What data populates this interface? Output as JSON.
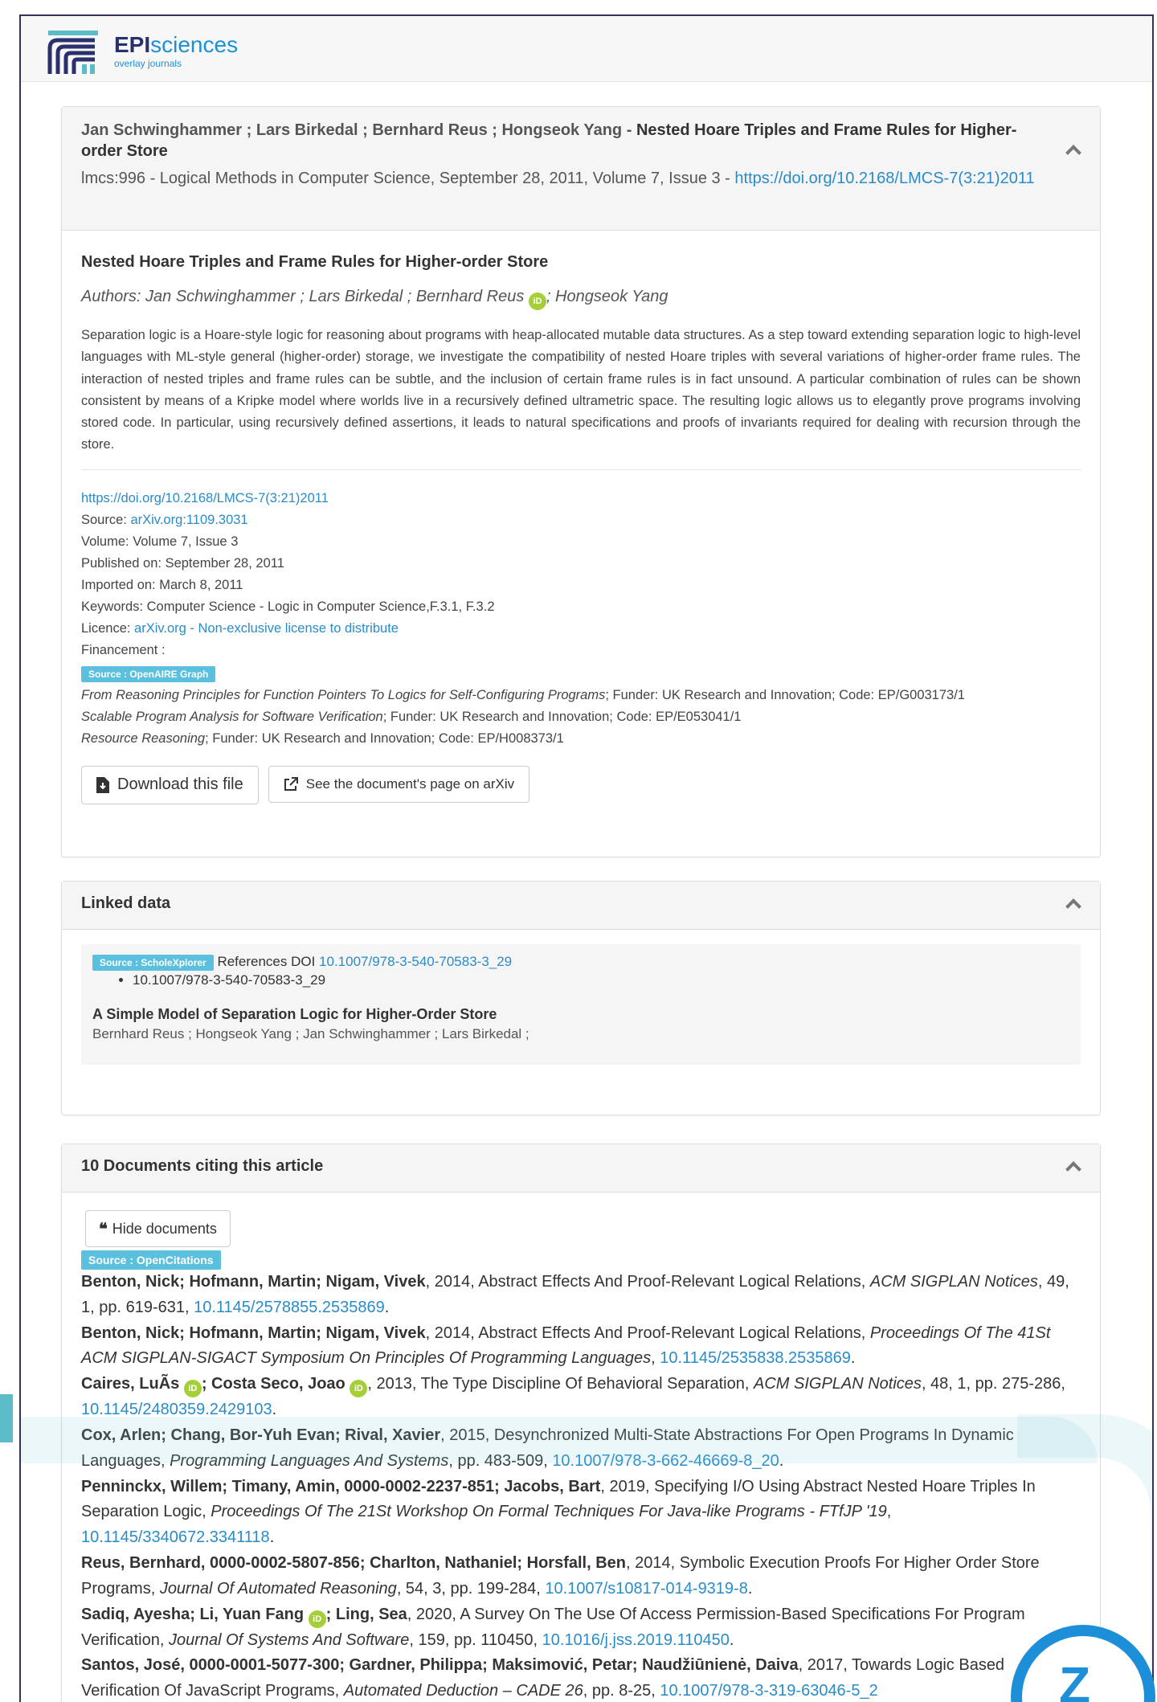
{
  "brand": {
    "epi": "EPI",
    "sciences": "sciences",
    "sub": "overlay journals"
  },
  "header": {
    "authors": "Jan Schwinghammer ; Lars Birkedal ; Bernhard Reus ; Hongseok Yang",
    "sep": " - ",
    "title": "Nested Hoare Triples and Frame Rules for Higher-order Store",
    "journal": "lmcs:996 - Logical Methods in Computer Science, September 28, 2011, Volume 7, Issue 3 - ",
    "doi_link": "https://doi.org/10.2168/LMCS-7(3:21)2011"
  },
  "article": {
    "title": "Nested Hoare Triples and Frame Rules for Higher-order Store",
    "authors_prefix": "Authors: Jan Schwinghammer ; Lars Birkedal ; Bernhard Reus",
    "authors_suffix": "; Hongseok Yang",
    "orcid": "iD",
    "abstract": "Separation logic is a Hoare-style logic for reasoning about programs with heap-allocated mutable data structures. As a step toward extending separation logic to high-level languages with ML-style general (higher-order) storage, we investigate the compatibility of nested Hoare triples with several variations of higher-order frame rules. The interaction of nested triples and frame rules can be subtle, and the inclusion of certain frame rules is in fact unsound. A particular combination of rules can be shown consistent by means of a Kripke model where worlds live in a recursively defined ultrametric space. The resulting logic allows us to elegantly prove programs involving stored code. In particular, using recursively defined assertions, it leads to natural specifications and proofs of invariants required for dealing with recursion through the store.",
    "doi": "https://doi.org/10.2168/LMCS-7(3:21)2011",
    "source_label": "Source: ",
    "source": "arXiv.org:1109.3031",
    "volume": "Volume: Volume 7, Issue 3",
    "published": "Published on: September 28, 2011",
    "imported": "Imported on: March 8, 2011",
    "keywords": "Keywords: Computer Science - Logic in Computer Science,F.3.1, F.3.2",
    "licence_label": "Licence: ",
    "licence": "arXiv.org - Non-exclusive license to distribute",
    "financement": "Financement :",
    "funding_badge": "Source : OpenAIRE Graph",
    "fundings": [
      {
        "title": "From Reasoning Principles for Function Pointers To Logics for Self-Configuring Programs",
        "rest": "; Funder: UK Research and Innovation; Code: EP/G003173/1"
      },
      {
        "title": "Scalable Program Analysis for Software Verification",
        "rest": "; Funder: UK Research and Innovation; Code: EP/E053041/1"
      },
      {
        "title": "Resource Reasoning",
        "rest": "; Funder: UK Research and Innovation; Code: EP/H008373/1"
      }
    ],
    "download_btn": "Download this file",
    "arxiv_btn": "See the document's page on arXiv"
  },
  "linked": {
    "heading": "Linked data",
    "badge": "Source : ScholeXplorer",
    "ref_label": "References DOI ",
    "ref_doi": "10.1007/978-3-540-70583-3_29",
    "bullet": "10.1007/978-3-540-70583-3_29",
    "title": "A Simple Model of Separation Logic for Higher-Order Store",
    "authors": "Bernhard Reus ; Hongseok Yang ; Jan Schwinghammer ; Lars Birkedal ;"
  },
  "citing": {
    "heading": "10 Documents citing this article",
    "hide_btn": "Hide documents",
    "badge": "Source : OpenCitations",
    "items": [
      {
        "a": "Benton, Nick; Hofmann, Martin; Nigam, Vivek",
        "t": ", 2014, Abstract Effects And Proof-Relevant Logical Relations, ",
        "j": "ACM SIGPLAN Notices",
        "r": ", 49, 1, pp. 619-631, ",
        "d": "10.1145/2578855.2535869",
        "e": "."
      },
      {
        "a": "Benton, Nick; Hofmann, Martin; Nigam, Vivek",
        "t": ", 2014, Abstract Effects And Proof-Relevant Logical Relations, ",
        "j": "Proceedings Of The 41St ACM SIGPLAN-SIGACT Symposium On Principles Of Programming Languages",
        "r": ", ",
        "d": "10.1145/2535838.2535869",
        "e": "."
      },
      {
        "a": "Caires, LuÃs",
        "a2": "; Costa Seco, Joao",
        "t": ", 2013, The Type Discipline Of Behavioral Separation, ",
        "j": "ACM SIGPLAN Notices",
        "r": ", 48, 1, pp. 275-286, ",
        "d": "10.1145/2480359.2429103",
        "e": "."
      },
      {
        "a": "Cox, Arlen; Chang, Bor-Yuh Evan; Rival, Xavier",
        "t": ", 2015, Desynchronized Multi-State Abstractions For Open Programs In Dynamic Languages, ",
        "j": "Programming Languages And Systems",
        "r": ", pp. 483-509, ",
        "d": "10.1007/978-3-662-46669-8_20",
        "e": "."
      },
      {
        "a": "Penninckx, Willem; Timany, Amin, 0000-0002-2237-851; Jacobs, Bart",
        "t": ", 2019, Specifying I/O Using Abstract Nested Hoare Triples In Separation Logic, ",
        "j": "Proceedings Of The 21St Workshop On Formal Techniques For Java-like Programs - FTfJP '19",
        "r": ", ",
        "d": "10.1145/3340672.3341118",
        "e": "."
      },
      {
        "a": "Reus, Bernhard, 0000-0002-5807-856; Charlton, Nathaniel; Horsfall, Ben",
        "t": ", 2014, Symbolic Execution Proofs For Higher Order Store Programs, ",
        "j": "Journal Of Automated Reasoning",
        "r": ", 54, 3, pp. 199-284, ",
        "d": "10.1007/s10817-014-9319-8",
        "e": "."
      },
      {
        "a": "Sadiq, Ayesha; Li, Yuan Fang",
        "a2": "; Ling, Sea",
        "t": ", 2020, A Survey On The Use Of Access Permission-Based Specifications For Program Verification, ",
        "j": "Journal Of Systems And Software",
        "r": ", 159, pp. 110450, ",
        "d": "10.1016/j.jss.2019.110450",
        "e": "."
      },
      {
        "a": "Santos, José, 0000-0001-5077-300; Gardner, Philippa; Maksimović, Petar; Naudžiūnienė, Daiva",
        "t": ", 2017, Towards Logic Based Verification Of JavaScript Programs, ",
        "j": "Automated Deduction – CADE 26",
        "r": ", pp. 8-25, ",
        "d": "10.1007/978-3-319-63046-5_2",
        "e": ""
      }
    ]
  },
  "colors": {
    "accent": "#2a8bc9",
    "badge": "#5bc0de",
    "orcid": "#a6ce39",
    "brand_dark": "#2a2f6e"
  }
}
